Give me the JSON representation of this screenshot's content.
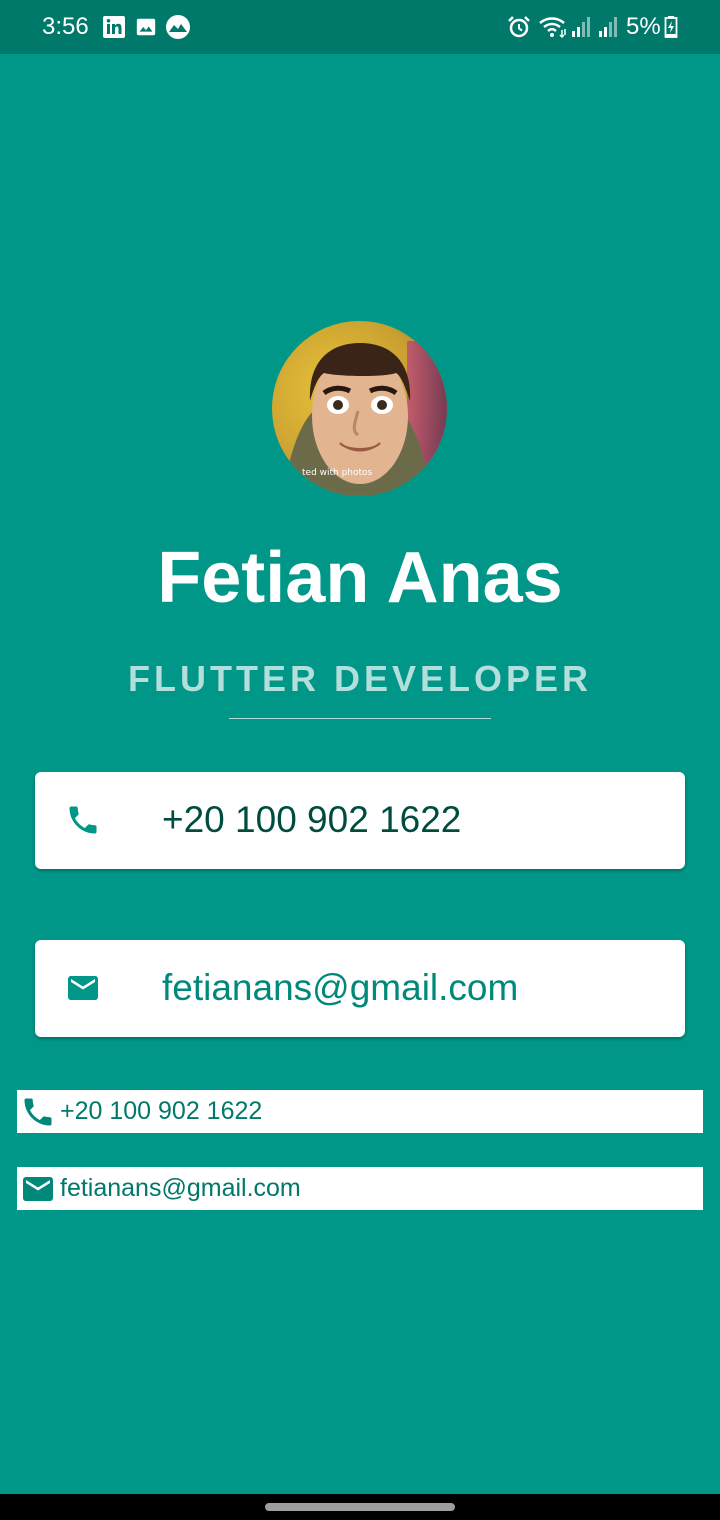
{
  "status_bar": {
    "time": "3:56",
    "battery": "5%",
    "icons": [
      "linkedin-icon",
      "gallery-icon",
      "app-icon",
      "alarm-icon",
      "wifi-icon",
      "signal-icon",
      "signal-icon",
      "battery-charging-icon"
    ]
  },
  "profile": {
    "avatar_watermark": "ted with photos",
    "name": "Fetian Anas",
    "title": "FLUTTER DEVELOPER"
  },
  "cards": {
    "phone": {
      "icon": "phone-icon",
      "text": "+20 100 902 1622"
    },
    "email": {
      "icon": "email-icon",
      "text": "fetianans@gmail.com"
    }
  },
  "rows": {
    "phone": {
      "icon": "phone-icon",
      "text": "+20 100 902 1622"
    },
    "email": {
      "icon": "email-icon",
      "text": "fetianans@gmail.com"
    }
  },
  "colors": {
    "background": "#009688",
    "status_bar": "#00796b",
    "subtitle": "#b2dfdb",
    "accent": "#00897b"
  }
}
